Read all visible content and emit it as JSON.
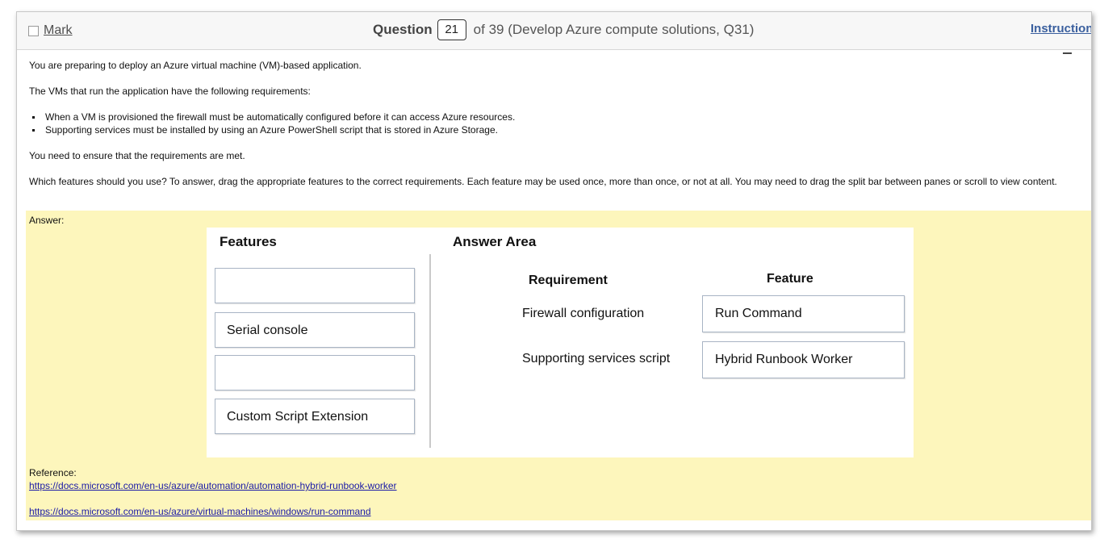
{
  "header": {
    "mark_label": "Mark",
    "question_label": "Question",
    "question_number": "21",
    "question_of": "of 39 (Develop Azure compute solutions, Q31)",
    "instructions_label": "Instructions"
  },
  "question": {
    "intro": "You are preparing to deploy an Azure virtual machine (VM)-based application.",
    "requirements_intro": "The VMs that run the application have the following requirements:",
    "bullets": [
      "When a VM is provisioned the firewall must be automatically configured before it can access Azure resources.",
      "Supporting services must be installed by using an Azure PowerShell script that is stored in Azure Storage."
    ],
    "ensure": "You need to ensure that the requirements are met.",
    "prompt": "Which features should you use? To answer, drag the appropriate features to the correct requirements. Each feature may be used once, more than once, or not at all. You may need to drag the split bar between panes or scroll to view content."
  },
  "answer": {
    "label": "Answer:",
    "features_title": "Features",
    "answer_area_title": "Answer Area",
    "features": [
      "",
      "Serial console",
      "",
      "Custom Script Extension"
    ],
    "requirement_header": "Requirement",
    "feature_header": "Feature",
    "rows": [
      {
        "requirement": "Firewall configuration",
        "feature": "Run Command"
      },
      {
        "requirement": "Supporting services script",
        "feature": "Hybrid Runbook Worker"
      }
    ]
  },
  "reference": {
    "label": "Reference:",
    "links": [
      "https://docs.microsoft.com/en-us/azure/automation/automation-hybrid-runbook-worker",
      "https://docs.microsoft.com/en-us/azure/virtual-machines/windows/run-command"
    ]
  },
  "colors": {
    "answer_background": "#fdf6bc",
    "link": "#1a1aa6",
    "instructions_link": "#3a5f9e"
  }
}
